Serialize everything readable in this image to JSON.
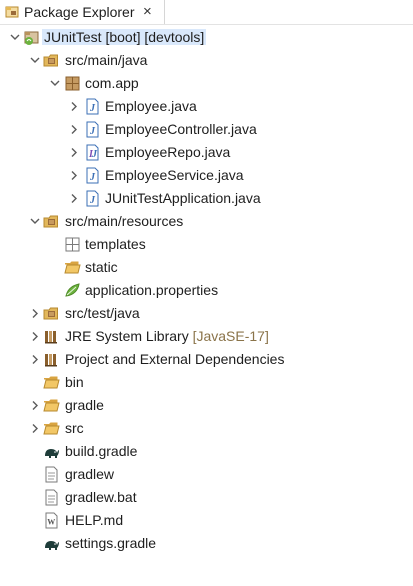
{
  "tab": {
    "title": "Package Explorer",
    "close": "×"
  },
  "tree": {
    "items": [
      {
        "label": "JUnitTest [boot] [devtools]",
        "icon": "spring-project-icon",
        "arrow": "expanded",
        "depth": 0,
        "selected": true
      },
      {
        "label": "src/main/java",
        "icon": "source-folder-icon",
        "arrow": "expanded",
        "depth": 1
      },
      {
        "label": "com.app",
        "icon": "package-icon",
        "arrow": "expanded",
        "depth": 2
      },
      {
        "label": "Employee.java",
        "icon": "java-file-icon",
        "arrow": "collapsed",
        "depth": 3
      },
      {
        "label": "EmployeeController.java",
        "icon": "java-file-icon",
        "arrow": "collapsed",
        "depth": 3
      },
      {
        "label": "EmployeeRepo.java",
        "icon": "java-interface-file-icon",
        "arrow": "collapsed",
        "depth": 3
      },
      {
        "label": "EmployeeService.java",
        "icon": "java-file-icon",
        "arrow": "collapsed",
        "depth": 3
      },
      {
        "label": "JUnitTestApplication.java",
        "icon": "java-file-icon",
        "arrow": "collapsed",
        "depth": 3
      },
      {
        "label": "src/main/resources",
        "icon": "source-folder-icon",
        "arrow": "expanded",
        "depth": 1
      },
      {
        "label": "templates",
        "icon": "empty-package-icon",
        "arrow": "none",
        "depth": 2
      },
      {
        "label": "static",
        "icon": "folder-open-icon",
        "arrow": "none",
        "depth": 2
      },
      {
        "label": "application.properties",
        "icon": "spring-leaf-icon",
        "arrow": "none",
        "depth": 2
      },
      {
        "label": "src/test/java",
        "icon": "source-folder-icon",
        "arrow": "collapsed",
        "depth": 1
      },
      {
        "label": "JRE System Library",
        "extra": "[JavaSE-17]",
        "icon": "library-icon",
        "arrow": "collapsed",
        "depth": 1
      },
      {
        "label": "Project and External Dependencies",
        "icon": "library-icon",
        "arrow": "collapsed",
        "depth": 1
      },
      {
        "label": "bin",
        "icon": "folder-icon",
        "arrow": "none",
        "depth": 1
      },
      {
        "label": "gradle",
        "icon": "folder-icon",
        "arrow": "collapsed",
        "depth": 1
      },
      {
        "label": "src",
        "icon": "folder-icon",
        "arrow": "collapsed",
        "depth": 1
      },
      {
        "label": "build.gradle",
        "icon": "gradle-elephant-icon",
        "arrow": "none",
        "depth": 1
      },
      {
        "label": "gradlew",
        "icon": "text-file-icon",
        "arrow": "none",
        "depth": 1
      },
      {
        "label": "gradlew.bat",
        "icon": "text-file-icon",
        "arrow": "none",
        "depth": 1
      },
      {
        "label": "HELP.md",
        "icon": "markdown-file-icon",
        "arrow": "none",
        "depth": 1
      },
      {
        "label": "settings.gradle",
        "icon": "gradle-elephant-icon",
        "arrow": "none",
        "depth": 1
      }
    ]
  },
  "colors": {
    "selection": "#d9e8fb",
    "java_blue": "#3b6fb6",
    "folder": "#d9a441",
    "package_brown": "#9b6b3a",
    "spring_green": "#6db33f",
    "decoration": "#8a7349"
  }
}
